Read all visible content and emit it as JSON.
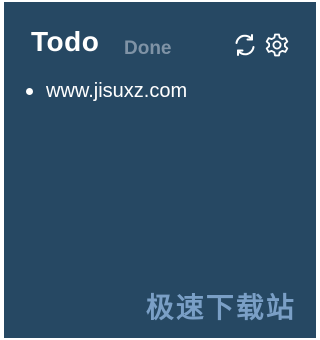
{
  "tabs": {
    "todo_label": "Todo",
    "done_label": "Done",
    "active": "Todo"
  },
  "toolbar": {
    "refresh_icon": "refresh-icon",
    "settings_icon": "gear-icon"
  },
  "todos": [
    {
      "text": "www.jisuxz.com"
    }
  ],
  "watermark": {
    "text": "极速下载站"
  },
  "colors": {
    "background": "#264863",
    "text": "#ffffff",
    "inactive_tab": "#7f93a6",
    "watermark": "#7a9fc6"
  }
}
